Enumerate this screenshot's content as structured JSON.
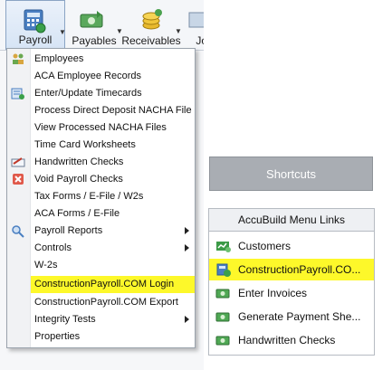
{
  "toolbar": {
    "items": [
      {
        "label": "Payroll",
        "icon": "payroll-calculator-icon"
      },
      {
        "label": "Payables",
        "icon": "payables-money-icon"
      },
      {
        "label": "Receivables",
        "icon": "receivables-coins-icon"
      },
      {
        "label": "Job",
        "icon": "jobs-icon"
      }
    ]
  },
  "menu": {
    "items": [
      {
        "label": "Employees",
        "icon": "employees-icon",
        "submenu": false
      },
      {
        "label": "ACA Employee Records",
        "icon": "",
        "submenu": false
      },
      {
        "label": "Enter/Update Timecards",
        "icon": "timecards-icon",
        "submenu": false
      },
      {
        "label": "Process Direct Deposit NACHA File",
        "icon": "",
        "submenu": false
      },
      {
        "label": "View Processed NACHA Files",
        "icon": "",
        "submenu": false
      },
      {
        "label": "Time Card Worksheets",
        "icon": "",
        "submenu": false
      },
      {
        "label": "Handwritten Checks",
        "icon": "handwritten-checks-icon",
        "submenu": false
      },
      {
        "label": "Void Payroll Checks",
        "icon": "void-icon",
        "submenu": false
      },
      {
        "label": "Tax Forms / E-File / W2s",
        "icon": "",
        "submenu": false
      },
      {
        "label": "ACA Forms / E-File",
        "icon": "",
        "submenu": false
      },
      {
        "label": "Payroll Reports",
        "icon": "reports-icon",
        "submenu": true
      },
      {
        "label": "Controls",
        "icon": "",
        "submenu": true
      },
      {
        "label": "W-2s",
        "icon": "",
        "submenu": false
      },
      {
        "label": "ConstructionPayroll.COM Login",
        "icon": "",
        "submenu": false
      },
      {
        "label": "ConstructionPayroll.COM Export",
        "icon": "",
        "submenu": false
      },
      {
        "label": "Integrity Tests",
        "icon": "",
        "submenu": true
      },
      {
        "label": "Properties",
        "icon": "",
        "submenu": false
      }
    ]
  },
  "shortcuts": {
    "button_label": "Shortcuts"
  },
  "links": {
    "title": "AccuBuild Menu Links",
    "items": [
      {
        "label": "Customers"
      },
      {
        "label": "ConstructionPayroll.CO..."
      },
      {
        "label": "Enter Invoices"
      },
      {
        "label": "Generate Payment She..."
      },
      {
        "label": "Handwritten Checks"
      }
    ]
  },
  "colors": {
    "highlight": "#fdf82a",
    "shortcuts_bg": "#a9adb3",
    "accent_green": "#2e8b3a"
  }
}
